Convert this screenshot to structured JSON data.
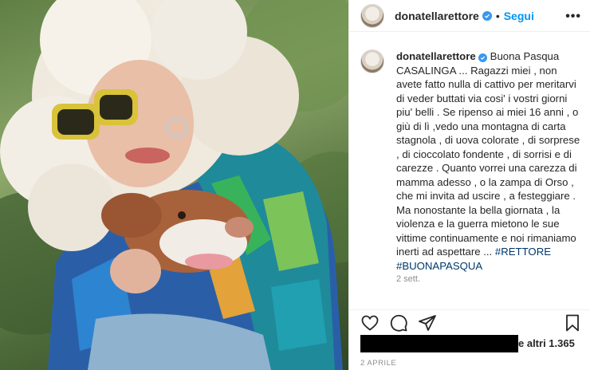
{
  "post": {
    "username": "donatellarettore",
    "follow_label": "Segui",
    "more_label": "•••",
    "separator": "•"
  },
  "caption": {
    "username": "donatellarettore",
    "text": "Buona Pasqua CASALINGA ... Ragazzi miei , non avete fatto nulla di cattivo per meritarvi di veder buttati via cosi' i vostri giorni piu' belli . Se ripenso ai miei 16 anni , o giù di lì ,vedo una montagna di carta stagnola , di uova colorate , di sorprese , di cioccolato fondente , di sorrisi e di carezze . Quanto vorrei una carezza di mamma adesso , o la zampa di Orso , che mi invita ad uscire , a festeggiare . Ma nonostante la bella giornata , la violenza e la guerra mietono le sue vittime continuamente e noi rimaniamo inerti ad aspettare ...",
    "hashtags": "#RETTORE #BUONAPASQUA",
    "time_ago": "2 sett."
  },
  "likes": {
    "text": "e altri 1.365"
  },
  "date": "2 APRILE",
  "icons": {
    "like": "heart-icon",
    "comment": "comment-icon",
    "share": "paper-plane-icon",
    "save": "bookmark-icon",
    "verified": "verified-badge-icon"
  },
  "colors": {
    "accent": "#0095f6",
    "verified": "#3897f0",
    "hashtag": "#00376b",
    "muted": "#8e8e8e"
  }
}
